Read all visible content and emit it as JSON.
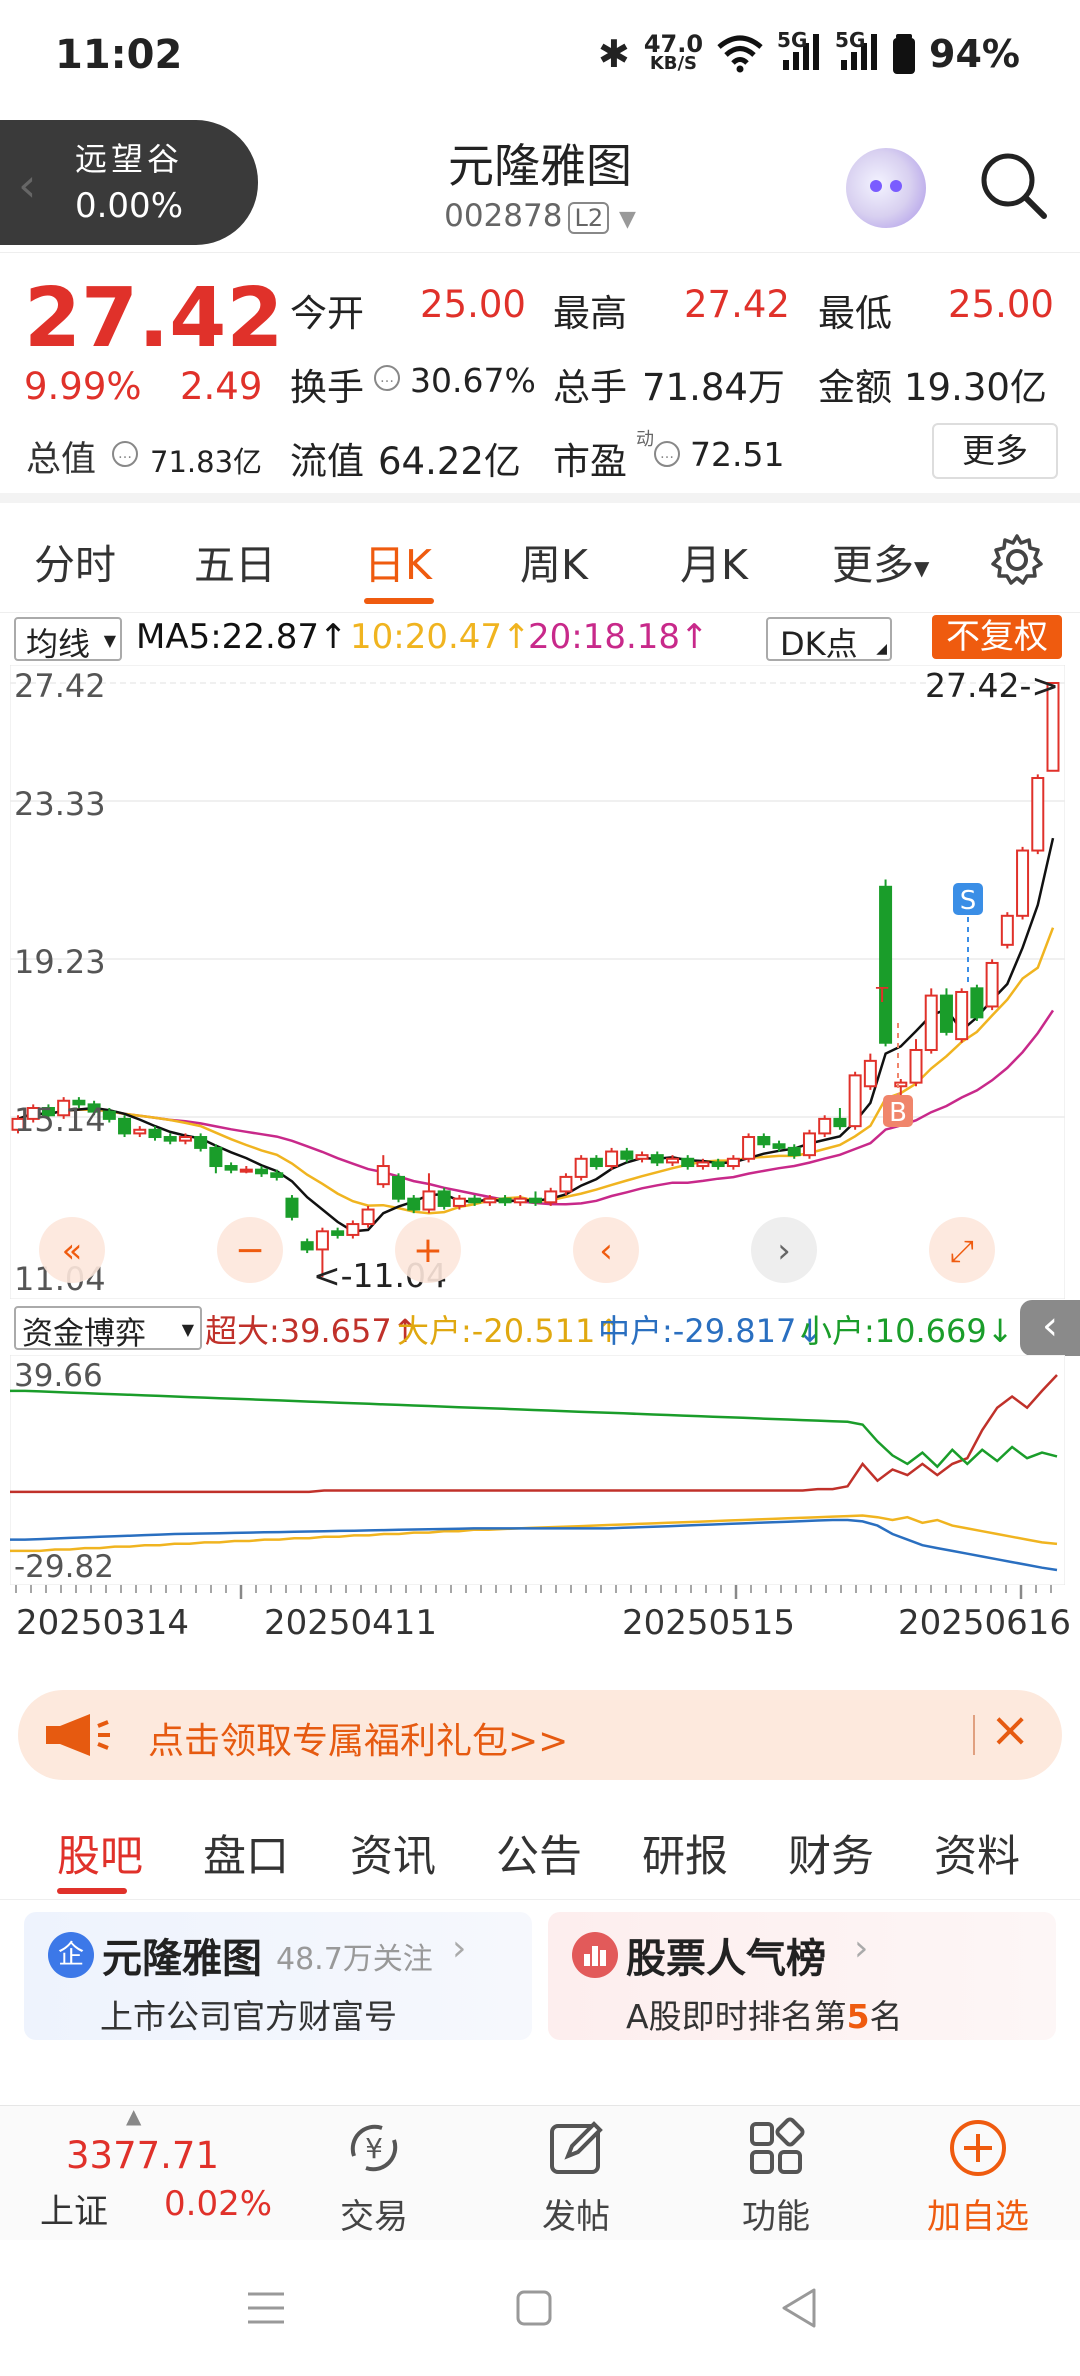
{
  "status": {
    "time": "11:02",
    "net_speed_top": "47.0",
    "net_speed_unit": "KB/S",
    "sig1": "5G",
    "sig2": "5G",
    "battery": "94%"
  },
  "header": {
    "index_name": "远望谷",
    "index_change": "0.00%",
    "stock_name": "元隆雅图",
    "stock_code": "002878",
    "level": "L2"
  },
  "quote": {
    "price": "27.42",
    "change_pct": "9.99%",
    "change_amt": "2.49",
    "open_label": "今开",
    "open": "25.00",
    "high_label": "最高",
    "high": "27.42",
    "low_label": "最低",
    "low": "25.00",
    "turnover_label": "换手",
    "turnover": "30.67%",
    "volume_label": "总手",
    "volume": "71.84万",
    "amount_label": "金额",
    "amount": "19.30亿",
    "mcap_label": "总值",
    "mcap": "71.83亿",
    "float_label": "流值",
    "float_cap": "64.22亿",
    "pe_label": "市盈",
    "pe_sup": "动",
    "pe": "72.51",
    "more": "更多"
  },
  "period_tabs": [
    "分时",
    "五日",
    "日K",
    "周K",
    "月K",
    "更多"
  ],
  "ma_bar": {
    "selector": "均线",
    "ma5": "MA5:22.87",
    "ma10": "10:20.47",
    "ma20": "20:18.18",
    "dk": "DK点",
    "fuquan": "不复权"
  },
  "colors": {
    "up": "#e0312a",
    "down": "#1a9d2a",
    "ma5": "#111111",
    "ma10": "#f0b420",
    "ma20": "#c8298a",
    "accent": "#ef5b0f"
  },
  "chart_data": [
    {
      "type": "candlestick",
      "y_ticks": [
        "27.42",
        "23.33",
        "19.23",
        "15.14",
        "11.04"
      ],
      "ylim": [
        11.04,
        27.42
      ],
      "annotations": {
        "max": "27.42->",
        "min": "<-11.04",
        "buy": "B",
        "sell": "S"
      },
      "candles": [
        [
          15.1,
          15.4,
          15.0,
          15.5,
          1
        ],
        [
          15.4,
          15.7,
          15.3,
          15.8,
          1
        ],
        [
          15.7,
          15.5,
          15.4,
          15.8,
          0
        ],
        [
          15.5,
          15.9,
          15.4,
          16.0,
          1
        ],
        [
          15.9,
          15.8,
          15.7,
          16.0,
          0
        ],
        [
          15.8,
          15.6,
          15.5,
          15.9,
          0
        ],
        [
          15.6,
          15.4,
          15.3,
          15.7,
          0
        ],
        [
          15.4,
          15.0,
          14.9,
          15.5,
          0
        ],
        [
          15.0,
          15.1,
          14.9,
          15.2,
          1
        ],
        [
          15.1,
          14.9,
          14.8,
          15.2,
          0
        ],
        [
          14.9,
          14.8,
          14.7,
          15.0,
          0
        ],
        [
          14.8,
          14.9,
          14.7,
          15.0,
          1
        ],
        [
          14.9,
          14.6,
          14.5,
          15.0,
          0
        ],
        [
          14.6,
          14.1,
          13.9,
          14.7,
          0
        ],
        [
          14.1,
          14.0,
          13.9,
          14.2,
          0
        ],
        [
          14.0,
          14.0,
          13.9,
          14.1,
          1
        ],
        [
          14.0,
          13.9,
          13.8,
          14.1,
          0
        ],
        [
          13.9,
          13.8,
          13.7,
          14.0,
          0
        ],
        [
          13.2,
          12.7,
          12.6,
          13.3,
          0
        ],
        [
          12.0,
          11.8,
          11.7,
          12.1,
          0
        ],
        [
          11.8,
          12.3,
          11.04,
          12.4,
          1
        ],
        [
          12.3,
          12.2,
          12.1,
          12.4,
          0
        ],
        [
          12.2,
          12.5,
          12.1,
          12.6,
          1
        ],
        [
          12.5,
          12.9,
          12.4,
          13.0,
          1
        ],
        [
          13.6,
          14.1,
          13.5,
          14.4,
          1
        ],
        [
          13.8,
          13.2,
          13.1,
          13.9,
          0
        ],
        [
          13.2,
          12.9,
          12.8,
          13.3,
          0
        ],
        [
          12.9,
          13.4,
          12.8,
          13.9,
          1
        ],
        [
          13.4,
          13.0,
          12.9,
          13.5,
          0
        ],
        [
          13.0,
          13.2,
          12.9,
          13.3,
          1
        ],
        [
          13.2,
          13.1,
          13.0,
          13.3,
          0
        ],
        [
          13.1,
          13.2,
          13.0,
          13.3,
          1
        ],
        [
          13.2,
          13.1,
          13.0,
          13.3,
          0
        ],
        [
          13.1,
          13.2,
          13.0,
          13.3,
          1
        ],
        [
          13.2,
          13.1,
          13.0,
          13.4,
          0
        ],
        [
          13.1,
          13.4,
          13.0,
          13.5,
          1
        ],
        [
          13.4,
          13.8,
          13.3,
          13.9,
          1
        ],
        [
          13.8,
          14.3,
          13.7,
          14.4,
          1
        ],
        [
          14.3,
          14.1,
          14.0,
          14.4,
          0
        ],
        [
          14.1,
          14.5,
          14.0,
          14.6,
          1
        ],
        [
          14.5,
          14.3,
          14.2,
          14.6,
          0
        ],
        [
          14.3,
          14.4,
          14.2,
          14.5,
          1
        ],
        [
          14.4,
          14.2,
          14.1,
          14.5,
          0
        ],
        [
          14.2,
          14.3,
          14.1,
          14.4,
          1
        ],
        [
          14.3,
          14.1,
          14.0,
          14.4,
          0
        ],
        [
          14.1,
          14.2,
          14.0,
          14.3,
          1
        ],
        [
          14.2,
          14.1,
          14.0,
          14.3,
          0
        ],
        [
          14.1,
          14.3,
          14.0,
          14.4,
          1
        ],
        [
          14.3,
          14.9,
          14.2,
          15.0,
          1
        ],
        [
          14.9,
          14.7,
          14.6,
          15.0,
          0
        ],
        [
          14.7,
          14.6,
          14.5,
          14.8,
          0
        ],
        [
          14.6,
          14.4,
          14.3,
          14.7,
          0
        ],
        [
          14.4,
          15.0,
          14.3,
          15.1,
          1
        ],
        [
          15.0,
          15.4,
          14.9,
          15.5,
          1
        ],
        [
          15.4,
          15.2,
          15.1,
          15.7,
          0
        ],
        [
          15.2,
          16.6,
          15.1,
          16.7,
          1
        ],
        [
          16.3,
          17.0,
          16.2,
          17.2,
          1
        ],
        [
          17.5,
          21.8,
          17.4,
          22.0,
          0
        ],
        [
          16.3,
          16.4,
          16.0,
          16.5,
          1
        ],
        [
          16.4,
          17.3,
          16.3,
          17.6,
          1
        ],
        [
          17.3,
          18.8,
          17.2,
          19.0,
          1
        ],
        [
          18.8,
          17.8,
          17.7,
          19.0,
          0
        ],
        [
          17.6,
          18.9,
          17.5,
          19.0,
          1
        ],
        [
          19.0,
          18.2,
          18.1,
          19.1,
          0
        ],
        [
          18.5,
          19.7,
          18.4,
          19.8,
          1
        ],
        [
          20.2,
          21.0,
          20.1,
          21.1,
          1
        ],
        [
          21.0,
          22.8,
          20.9,
          22.9,
          1
        ],
        [
          22.8,
          24.8,
          22.7,
          24.9,
          1
        ],
        [
          25.0,
          27.42,
          25.0,
          27.42,
          1
        ]
      ]
    },
    {
      "type": "line",
      "y_ticks": [
        "39.66",
        "-29.82"
      ],
      "x_ticks": [
        "20250314",
        "20250411",
        "20250515",
        "20250616"
      ],
      "series": [
        {
          "name": "超大",
          "value_label": "超大:39.657",
          "color": "#c0312a",
          "values": [
            -2,
            -2,
            -2,
            -2,
            -2,
            -2,
            -2,
            -2,
            -2,
            -2,
            -2,
            -2,
            -2,
            -2,
            -2,
            -2,
            -2,
            -2,
            -2,
            -2,
            -2,
            -1.5,
            -1.5,
            -1.5,
            -1.5,
            -1.5,
            -1.5,
            -1.5,
            -1.5,
            -1.5,
            -1.5,
            -1.5,
            -1.5,
            -1.5,
            -1.5,
            -1.5,
            -1.5,
            -1.5,
            -1.5,
            -1.5,
            -1.5,
            -1.5,
            -1.5,
            -1.5,
            -1.5,
            -1.5,
            -1.5,
            -1.5,
            -1.5,
            -1.5,
            -1.5,
            -1.5,
            -1.5,
            -1.5,
            -1,
            -1,
            0,
            8,
            2,
            6,
            4,
            8,
            4,
            8,
            10,
            20,
            28,
            32,
            28,
            34,
            39.66
          ]
        },
        {
          "name": "大户",
          "value_label": "大户:-20.511",
          "color": "#f0b420",
          "values": [
            -23,
            -23,
            -23,
            -22.5,
            -22.5,
            -22,
            -22,
            -21.5,
            -21.5,
            -21,
            -21,
            -20.5,
            -20.5,
            -20,
            -20,
            -19.5,
            -19.5,
            -19,
            -19,
            -18.5,
            -18.5,
            -18,
            -18,
            -17.5,
            -17.5,
            -17,
            -17,
            -16.5,
            -16.5,
            -16,
            -16,
            -15.5,
            -15.5,
            -15.2,
            -15,
            -14.8,
            -14.6,
            -14.4,
            -14.2,
            -14,
            -13.8,
            -13.6,
            -13.4,
            -13.2,
            -13,
            -12.8,
            -12.6,
            -12.4,
            -12.2,
            -12,
            -11.8,
            -11.6,
            -11.4,
            -11.2,
            -11,
            -10.8,
            -10.6,
            -10.4,
            -11,
            -12,
            -11,
            -13,
            -12,
            -14,
            -15,
            -16,
            -17,
            -18,
            -19,
            -20,
            -20.51
          ]
        },
        {
          "name": "中户",
          "value_label": "中户:-29.817",
          "color": "#2a6fc0",
          "values": [
            -19,
            -19,
            -18.8,
            -18.6,
            -18.4,
            -18.2,
            -18,
            -17.8,
            -17.6,
            -17.4,
            -17.2,
            -17,
            -16.9,
            -16.8,
            -16.7,
            -16.6,
            -16.5,
            -16.4,
            -16.3,
            -16.2,
            -16.1,
            -16,
            -15.9,
            -15.8,
            -15.7,
            -15.6,
            -15.5,
            -15.4,
            -15.3,
            -15.2,
            -15.1,
            -15,
            -15,
            -15,
            -15,
            -15,
            -15,
            -15,
            -15,
            -15,
            -15,
            -14.8,
            -14.6,
            -14.4,
            -14.2,
            -14,
            -13.8,
            -13.6,
            -13.4,
            -13.2,
            -13,
            -12.8,
            -12.6,
            -12.4,
            -12.2,
            -12,
            -12,
            -12.5,
            -14,
            -17,
            -19,
            -21,
            -22,
            -23,
            -24,
            -25,
            -26,
            -27,
            -28,
            -29,
            -29.82
          ]
        },
        {
          "name": "小户",
          "value_label": "小户:10.669",
          "color": "#1a9d2a",
          "values": [
            34,
            34,
            33.8,
            33.6,
            33.4,
            33.2,
            33,
            32.8,
            32.6,
            32.4,
            32.2,
            32,
            31.8,
            31.6,
            31.4,
            31.2,
            31,
            30.8,
            30.6,
            30.4,
            30.2,
            30,
            29.8,
            29.6,
            29.4,
            29.2,
            29,
            28.8,
            28.6,
            28.4,
            28.2,
            28,
            27.8,
            27.6,
            27.4,
            27.2,
            27,
            26.8,
            26.6,
            26.4,
            26.2,
            26,
            25.8,
            25.6,
            25.4,
            25.2,
            25,
            24.8,
            24.6,
            24.4,
            24.2,
            24,
            23.8,
            23.6,
            23.4,
            23.2,
            23,
            22,
            16,
            11,
            8,
            12,
            7,
            13,
            8,
            13,
            9,
            14,
            10,
            12,
            10.669
          ]
        }
      ]
    }
  ],
  "fund_bar": {
    "selector": "资金博弈"
  },
  "promo": {
    "text": "点击领取专属福利礼包>>"
  },
  "content_tabs": [
    "股吧",
    "盘口",
    "资讯",
    "公告",
    "研报",
    "财务",
    "资料"
  ],
  "card1": {
    "badge": "企",
    "title": "元隆雅图",
    "followers": "48.7万关注",
    "subtitle": "上市公司官方财富号"
  },
  "card2": {
    "title": "股票人气榜",
    "subtitle_prefix": "A股即时排名第",
    "rank": "5",
    "subtitle_suffix": "名"
  },
  "bottom_bar": {
    "index_value": "3377.71",
    "index_name": "上证",
    "index_change": "0.02%",
    "trade": "交易",
    "post": "发帖",
    "func": "功能",
    "add": "加自选"
  }
}
